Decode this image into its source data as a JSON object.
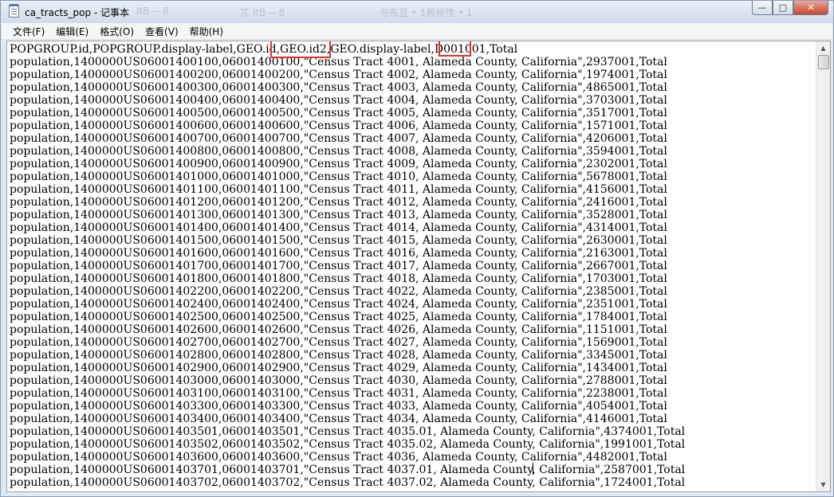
{
  "window": {
    "title": "ca_tracts_pop - 记事本",
    "ghost_titles": [
      "ItB -- 8",
      "兀 ItB -- 8",
      "与布豆 • 1赖屋性 • 1"
    ]
  },
  "caption": {
    "minimize": "—",
    "maximize": "□",
    "close": "✕"
  },
  "menu": {
    "items": [
      "文件(F)",
      "编辑(E)",
      "格式(O)",
      "查看(V)",
      "帮助(H)"
    ]
  },
  "editor": {
    "lines": [
      "POPGROUP.id,POPGROUP.display-label,GEO.id,GEO.id2,GEO.display-label,D001001,Total",
      "population,1400000US06001400100,06001400100,\"Census Tract 4001, Alameda County, California\",2937001,Total",
      "population,1400000US06001400200,06001400200,\"Census Tract 4002, Alameda County, California\",1974001,Total",
      "population,1400000US06001400300,06001400300,\"Census Tract 4003, Alameda County, California\",4865001,Total",
      "population,1400000US06001400400,06001400400,\"Census Tract 4004, Alameda County, California\",3703001,Total",
      "population,1400000US06001400500,06001400500,\"Census Tract 4005, Alameda County, California\",3517001,Total",
      "population,1400000US06001400600,06001400600,\"Census Tract 4006, Alameda County, California\",1571001,Total",
      "population,1400000US06001400700,06001400700,\"Census Tract 4007, Alameda County, California\",4206001,Total",
      "population,1400000US06001400800,06001400800,\"Census Tract 4008, Alameda County, California\",3594001,Total",
      "population,1400000US06001400900,06001400900,\"Census Tract 4009, Alameda County, California\",2302001,Total",
      "population,1400000US06001401000,06001401000,\"Census Tract 4010, Alameda County, California\",5678001,Total",
      "population,1400000US06001401100,06001401100,\"Census Tract 4011, Alameda County, California\",4156001,Total",
      "population,1400000US06001401200,06001401200,\"Census Tract 4012, Alameda County, California\",2416001,Total",
      "population,1400000US06001401300,06001401300,\"Census Tract 4013, Alameda County, California\",3528001,Total",
      "population,1400000US06001401400,06001401400,\"Census Tract 4014, Alameda County, California\",4314001,Total",
      "population,1400000US06001401500,06001401500,\"Census Tract 4015, Alameda County, California\",2630001,Total",
      "population,1400000US06001401600,06001401600,\"Census Tract 4016, Alameda County, California\",2163001,Total",
      "population,1400000US06001401700,06001401700,\"Census Tract 4017, Alameda County, California\",2667001,Total",
      "population,1400000US06001401800,06001401800,\"Census Tract 4018, Alameda County, California\",1703001,Total",
      "population,1400000US06001402200,06001402200,\"Census Tract 4022, Alameda County, California\",2385001,Total",
      "population,1400000US06001402400,06001402400,\"Census Tract 4024, Alameda County, California\",2351001,Total",
      "population,1400000US06001402500,06001402500,\"Census Tract 4025, Alameda County, California\",1784001,Total",
      "population,1400000US06001402600,06001402600,\"Census Tract 4026, Alameda County, California\",1151001,Total",
      "population,1400000US06001402700,06001402700,\"Census Tract 4027, Alameda County, California\",1569001,Total",
      "population,1400000US06001402800,06001402800,\"Census Tract 4028, Alameda County, California\",3345001,Total",
      "population,1400000US06001402900,06001402900,\"Census Tract 4029, Alameda County, California\",1434001,Total",
      "population,1400000US06001403000,06001403000,\"Census Tract 4030, Alameda County, California\",2788001,Total",
      "population,1400000US06001403100,06001403100,\"Census Tract 4031, Alameda County, California\",2238001,Total",
      "population,1400000US06001403300,06001403300,\"Census Tract 4033, Alameda County, California\",4054001,Total",
      "population,1400000US06001403400,06001403400,\"Census Tract 4034, Alameda County, California\",4146001,Total",
      "population,1400000US06001403501,06001403501,\"Census Tract 4035.01, Alameda County, California\",4374001,Total",
      "population,1400000US06001403502,06001403502,\"Census Tract 4035.02, Alameda County, California\",1991001,Total",
      "population,1400000US06001403600,06001403600,\"Census Tract 4036, Alameda County, California\",4482001,Total",
      "population,1400000US06001403701,06001403701,\"Census Tract 4037.01, Alameda County, California\",2587001,Total",
      "population,1400000US06001403702,06001403702,\"Census Tract 4037.02, Alameda County, California\",1724001,Total"
    ]
  },
  "scrollbar": {
    "up_arrow": "▲",
    "down_arrow": "▼"
  },
  "colors": {
    "highlight": "#e8302a",
    "close_button": "#c9432f",
    "window_frame": "#dfe9f5"
  }
}
